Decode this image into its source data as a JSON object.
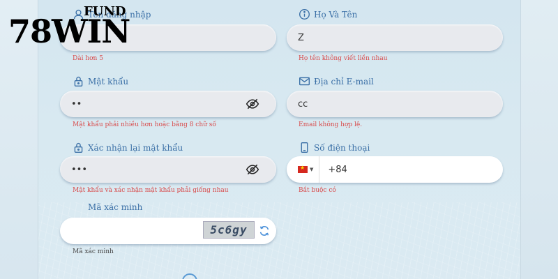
{
  "brand": {
    "fund_text": "FUND",
    "main_text": "78WIN"
  },
  "form": {
    "username": {
      "label": "Tên đăng nhập",
      "value": "",
      "help": "Dài hơn 5"
    },
    "fullname": {
      "label": "Họ Và Tên",
      "value": "Z",
      "help": "Họ tên không viết liền nhau"
    },
    "password": {
      "label": "Mật khẩu",
      "value": "••",
      "help": "Mật khẩu phải nhiều hơn hoặc bằng 8 chữ số"
    },
    "email": {
      "label": "Địa chỉ E-mail",
      "value": "cc",
      "help": "Email không hợp lệ."
    },
    "confirm_password": {
      "label": "Xác nhận lại mật khẩu",
      "value": "•••",
      "help": "Mật khẩu và xác nhận mật khẩu phải giống nhau"
    },
    "phone": {
      "label": "Số điện thoại",
      "country_code": "+84",
      "flag": "vn-flag-icon",
      "help": "Bắt buộc có"
    },
    "captcha": {
      "label": "Mã xác minh",
      "value": "",
      "image_text": "5c6gy",
      "help": "Mã xác minh"
    }
  },
  "colors": {
    "label": "#3a6fa6",
    "error": "#d84a4a",
    "field_bg": "#e8eaee",
    "page_bg": "#d9e9f2"
  }
}
